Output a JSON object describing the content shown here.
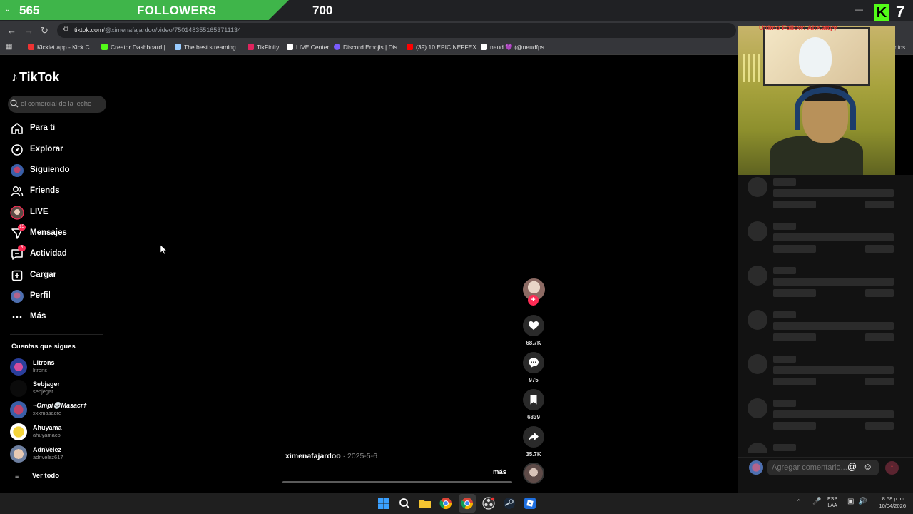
{
  "stream_overlay": {
    "followers_count": "565",
    "followers_label": "FOLLOWERS",
    "followers_goal": "700",
    "kick_logo": "K",
    "kick_viewers": "7",
    "alert_text": "Ultimo Follow: AltKattyy"
  },
  "browser": {
    "url_host": "tiktok.com",
    "url_path": "/@ximenafajardoo/video/7501483551653711134",
    "bookmarks": [
      {
        "label": "Kicklet.app - Kick C...",
        "color": "#e33"
      },
      {
        "label": "Creator Dashboard |...",
        "color": "#53fc18"
      },
      {
        "label": "The best streaming...",
        "color": "#9cf"
      },
      {
        "label": "TikFinity",
        "color": "#e0245e"
      },
      {
        "label": "LIVE Center",
        "color": "#222"
      },
      {
        "label": "Discord Emojis | Dis...",
        "color": "#7a5cff"
      },
      {
        "label": "(39) 10 EPIC NEFFEX...",
        "color": "#f00"
      },
      {
        "label": "neud 💜 (@neudfps...",
        "color": "#222"
      }
    ],
    "bookmarks_overflow": "ritos"
  },
  "tiktok": {
    "logo": "TikTok",
    "search_placeholder": "el comercial de la leche",
    "nav": [
      {
        "label": "Para ti",
        "icon": "home-icon"
      },
      {
        "label": "Explorar",
        "icon": "compass-icon"
      },
      {
        "label": "Siguiendo",
        "icon": "avatar-icon"
      },
      {
        "label": "Friends",
        "icon": "friends-icon"
      },
      {
        "label": "LIVE",
        "icon": "live-avatar-icon"
      },
      {
        "label": "Mensajes",
        "icon": "messages-icon",
        "badge": "15"
      },
      {
        "label": "Actividad",
        "icon": "activity-icon",
        "badge": "5"
      },
      {
        "label": "Cargar",
        "icon": "upload-icon"
      },
      {
        "label": "Perfil",
        "icon": "profile-avatar-icon"
      },
      {
        "label": "Más",
        "icon": "more-icon"
      }
    ],
    "following_title": "Cuentas que sigues",
    "accounts": [
      {
        "name": "Litrons",
        "handle": "litrons"
      },
      {
        "name": "Sebjager",
        "handle": "sebjegar"
      },
      {
        "name": "~Ompi💀Masacr†",
        "handle": "xxxmasacre"
      },
      {
        "name": "Ahuyama",
        "handle": "ahuyamaco"
      },
      {
        "name": "AdnVelez",
        "handle": "adnvelez617"
      }
    ],
    "see_all": "Ver todo",
    "video": {
      "author": "ximenafajardoo",
      "date": " · 2025-5-6",
      "more": "más"
    },
    "actions": {
      "likes": "68.7K",
      "comments": "975",
      "saves": "6839",
      "shares": "35.7K"
    },
    "comment_placeholder": "Agregar comentario...",
    "comment_at": "@",
    "comment_emoji": "☺",
    "comment_send": "↑"
  },
  "taskbar": {
    "lang_top": "ESP",
    "lang_bottom": "LAA",
    "time": "8:58 p. m.",
    "date": "10/04/2026"
  }
}
